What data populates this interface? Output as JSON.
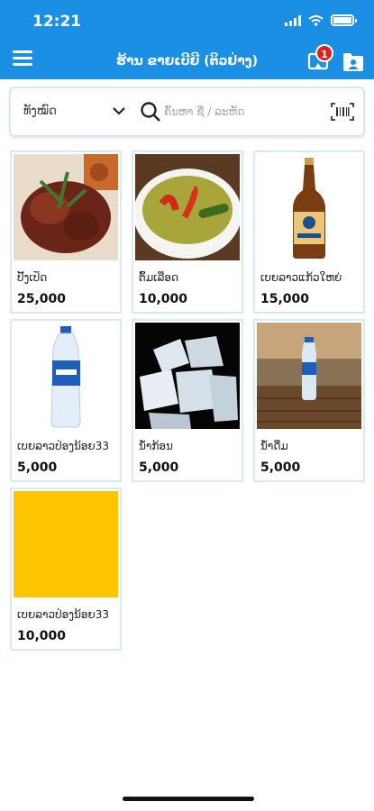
{
  "status": {
    "time": "12:21"
  },
  "header": {
    "title": "ຮ້ານ ຂາຍເບີຍີ (ຕິວຢ່າງ)",
    "notification_count": "1"
  },
  "search": {
    "category_label": "ທັງໝົດ",
    "placeholder": "ຄົ້ນຫາ ຊື່ / ລະຫັດ"
  },
  "products": [
    {
      "name": "ປີ້ງເປັດ",
      "price": "25,000",
      "image": "grilled-duck"
    },
    {
      "name": "ຕົ້ມເລືອດ",
      "price": "10,000",
      "image": "green-curry-soup"
    },
    {
      "name": "ເບຍລາວແກ້ວໃຫຍ່",
      "price": "15,000",
      "image": "beer-bottle"
    },
    {
      "name": "ເບຍລາວປ່ອງນ້ອຍ33",
      "price": "5,000",
      "image": "water-bottle"
    },
    {
      "name": "ນ້ຳກ້ອນ",
      "price": "5,000",
      "image": "ice-cubes"
    },
    {
      "name": "ນ້ຳດື່ມ",
      "price": "5,000",
      "image": "water-bottle-sunset"
    },
    {
      "name": "ເບຍລາວປ່ອງນ້ອຍ33",
      "price": "10,000",
      "image": "yellow-placeholder"
    }
  ],
  "colors": {
    "brand": "#1a8fe3",
    "card_border": "#d6eaf8",
    "badge": "#e02020"
  }
}
